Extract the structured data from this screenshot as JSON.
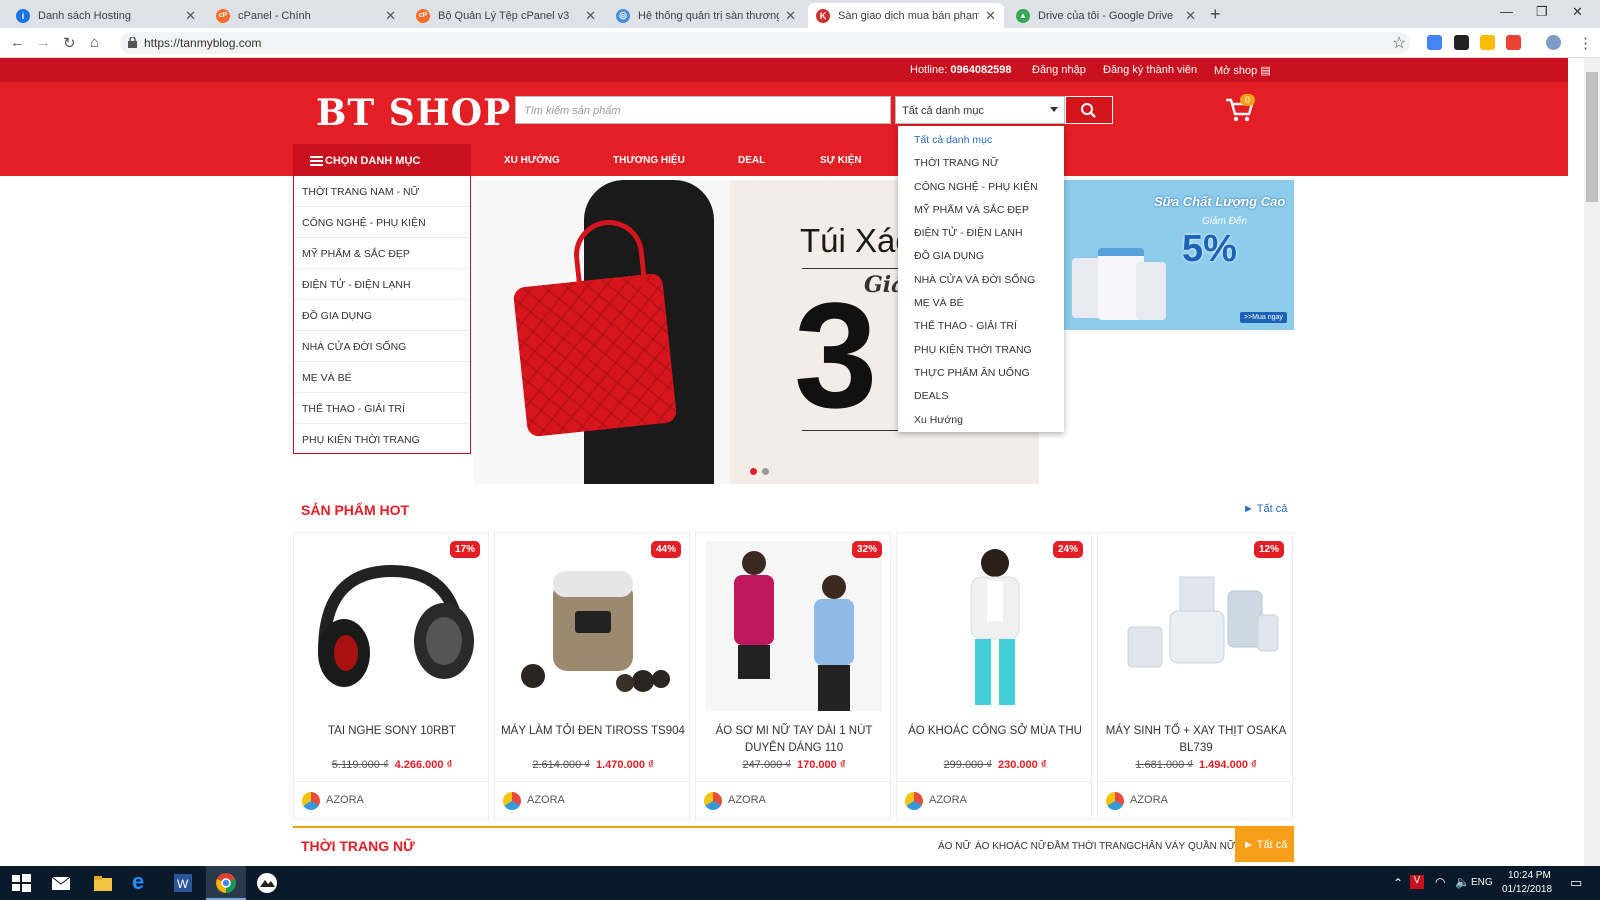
{
  "browser": {
    "tabs": [
      {
        "title": "Danh sách Hosting",
        "color": "#1a73e8",
        "glyph": "i"
      },
      {
        "title": "cPanel - Chính",
        "color": "#ff6c2c",
        "glyph": "cP"
      },
      {
        "title": "Bộ Quản Lý Tệp cPanel v3",
        "color": "#ff6c2c",
        "glyph": "cP"
      },
      {
        "title": "Hệ thống quản trị sàn thương m",
        "color": "#4a90d9",
        "glyph": "◎"
      },
      {
        "title": "Sàn giao dịch mua bán phạm vi c",
        "color": "#d32f2f",
        "glyph": "K"
      },
      {
        "title": "Drive của tôi - Google Drive",
        "color": "#34a853",
        "glyph": "▲"
      }
    ],
    "new_tab": "+",
    "url": "https://tanmyblog.com"
  },
  "topbar": {
    "hotline_label": "Hotline:",
    "hotline_number": "0964082598",
    "login": "Đăng nhập",
    "register": "Đăng ký thành viên",
    "open_shop": "Mở shop"
  },
  "header": {
    "logo": "BT SHOP",
    "search_placeholder": "Tìm kiếm sản phẩm",
    "category_select": "Tất cả danh mục",
    "cart_count": "0"
  },
  "nav": {
    "category_button": "CHỌN DANH MỤC",
    "items": [
      "XU HƯỚNG",
      "THƯƠNG HIỆU",
      "DEAL",
      "SỰ KIỆN"
    ]
  },
  "sidebar": {
    "items": [
      "THỜI TRANG NAM - NỮ",
      "CÔNG NGHỆ - PHỤ KIỆN",
      "MỸ PHẨM & SẮC ĐẸP",
      "ĐIỆN TỬ - ĐIỆN LẠNH",
      "ĐỒ GIA DỤNG",
      "NHÀ CỬA ĐỜI SỐNG",
      "MẸ VÀ BÉ",
      "THỂ THAO - GIẢI TRÍ",
      "PHỤ KIỆN THỜI TRANG"
    ]
  },
  "dropdown": {
    "options": [
      "Tất cả danh mục",
      "THỜI TRANG NỮ",
      "CÔNG NGHỆ - PHỤ KIỆN",
      "MỸ PHẨM VÀ SẮC ĐẸP",
      "ĐIỆN TỬ - ĐIỆN LẠNH",
      "ĐỒ GIA DỤNG",
      "NHÀ CỬA VÀ ĐỜI SỐNG",
      "MẸ VÀ BÉ",
      "THỂ THAO - GIẢI TRÍ",
      "PHỤ KIỆN THỜI TRANG",
      "THỰC PHẨM ĂN UỐNG",
      "DEALS",
      "Xu Hướng"
    ],
    "selected": "Tất cả danh mục"
  },
  "banner": {
    "headline": "Túi Xác",
    "sub": "Giá",
    "number": "3"
  },
  "side_banner": {
    "title": "Sữa Chất Lượng Cao",
    "sub": "Giảm Đến",
    "percent": "5%",
    "cta": ">>Mua ngay"
  },
  "hot": {
    "title": "SẢN PHẨM HOT",
    "view_all": "► Tất cả",
    "products": [
      {
        "name": "TAI NGHE SONY 10RBT",
        "old_price": "5.119.000 ₫",
        "new_price": "4.266.000 ₫",
        "discount": "17%",
        "shop": "AZORA"
      },
      {
        "name": "MÁY LÀM TỎI ĐEN TIROSS TS904",
        "old_price": "2.614.000 ₫",
        "new_price": "1.470.000 ₫",
        "discount": "44%",
        "shop": "AZORA"
      },
      {
        "name": "ÁO SƠ MI NỮ TAY DÀI 1 NÚT DUYÊN DÁNG 110",
        "old_price": "247.000 ₫",
        "new_price": "170.000 ₫",
        "discount": "32%",
        "shop": "AZORA"
      },
      {
        "name": "ÁO KHOÁC CÔNG SỞ MÙA THU",
        "old_price": "299.000 ₫",
        "new_price": "230.000 ₫",
        "discount": "24%",
        "shop": "AZORA"
      },
      {
        "name": "MÁY SINH TỐ + XAY THỊT OSAKA BL739",
        "old_price": "1.681.000 ₫",
        "new_price": "1.494.000 ₫",
        "discount": "12%",
        "shop": "AZORA"
      }
    ]
  },
  "fashion": {
    "title": "THỜI TRANG NỮ",
    "links": [
      "ÁO NỮ",
      "ÁO KHOÁC NỮ",
      "ĐẦM THỜI TRANG",
      "CHÂN VÁY",
      "QUẦN NỮ"
    ],
    "view_all": "► Tất cả"
  },
  "taskbar": {
    "lang": "ENG",
    "time": "10:24 PM",
    "date": "01/12/2018"
  }
}
